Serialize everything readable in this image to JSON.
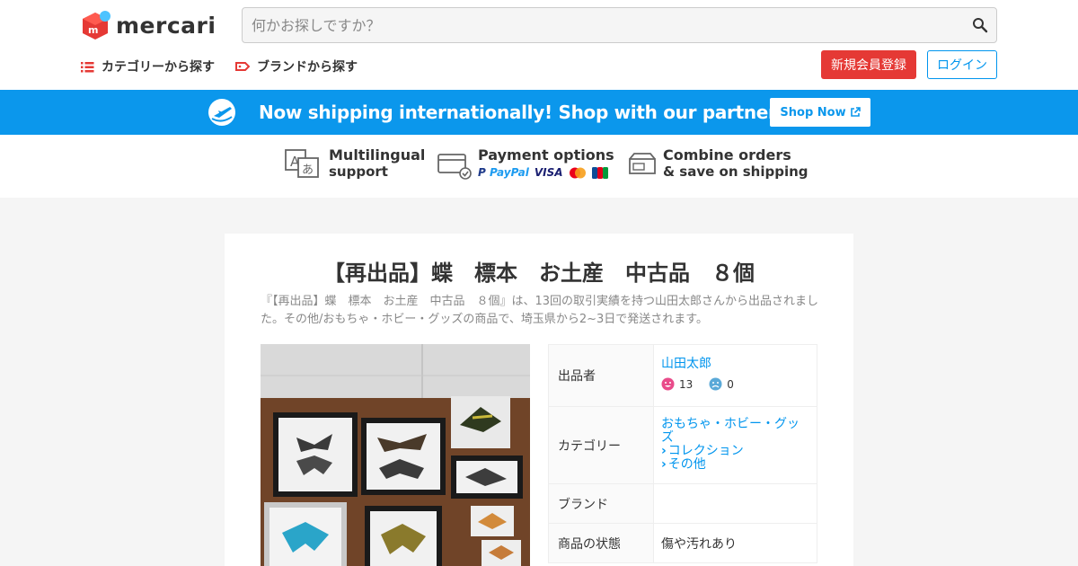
{
  "header": {
    "logo_text": "mercari",
    "search_placeholder": "何かお探しですか？",
    "nav_category": "カテゴリーから探す",
    "nav_brand": "ブランドから探す",
    "signup_label": "新規会員登録",
    "login_label": "ログイン"
  },
  "banner": {
    "text": "Now shipping internationally! Shop with our partner Buyee!",
    "button_label": "Shop Now"
  },
  "features": [
    {
      "line1": "Multilingual",
      "line2": "support"
    },
    {
      "line1": "Payment options",
      "paypal": "PayPal",
      "visa": "VISA"
    },
    {
      "line1": "Combine orders",
      "line2": "& save on shipping"
    }
  ],
  "item": {
    "title": "【再出品】蝶　標本　お土産　中古品　８個",
    "description": "『【再出品】蝶　標本　お土産　中古品　８個』は、13回の取引実績を持つ山田太郎さんから出品されました。その他/おもちゃ・ホビー・グッズの商品で、埼玉県から2~3日で発送されます。",
    "details": {
      "seller_label": "出品者",
      "seller_name": "山田太郎",
      "rating_good": "13",
      "rating_bad": "0",
      "category_label": "カテゴリー",
      "category_1": "おもちゃ・ホビー・グッズ",
      "category_2": "コレクション",
      "category_3": "その他",
      "brand_label": "ブランド",
      "brand_value": "",
      "condition_label": "商品の状態",
      "condition_value": "傷や汚れあり"
    }
  },
  "colors": {
    "brand_red": "#e53935",
    "accent_blue": "#0095ee",
    "banner_blue": "#0b97ec"
  }
}
